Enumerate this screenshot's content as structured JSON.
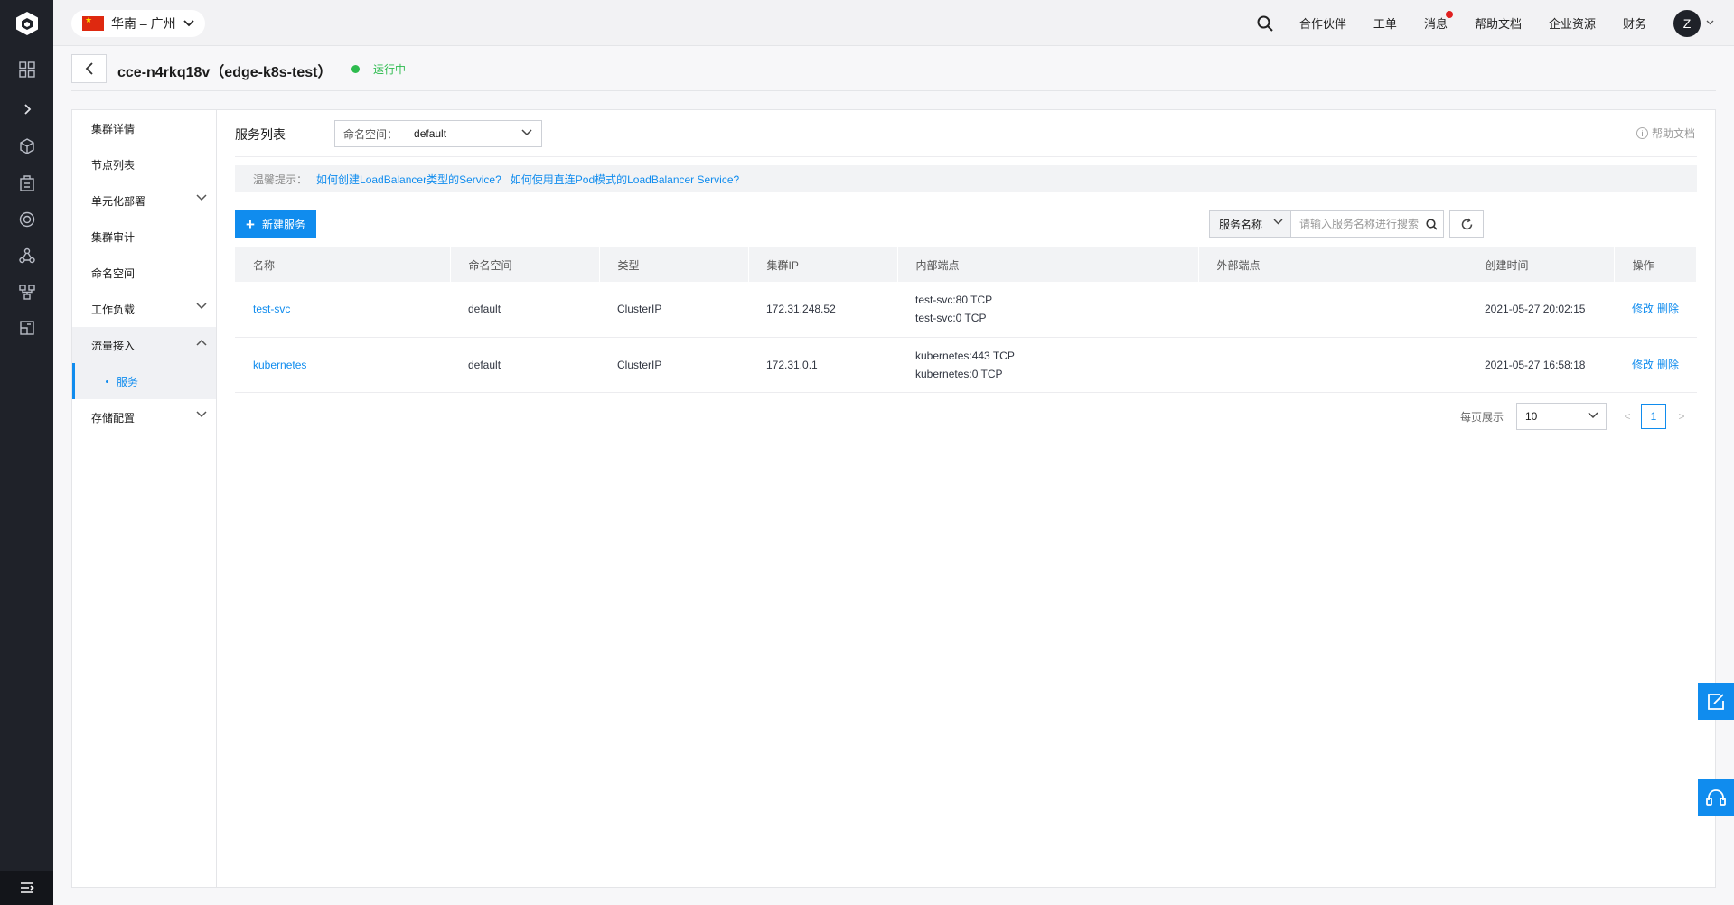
{
  "topbar": {
    "region": "华南 – 广州",
    "links": [
      "合作伙伴",
      "工单",
      "消息",
      "帮助文档",
      "企业资源",
      "财务"
    ],
    "avatar": "Z"
  },
  "header": {
    "cluster_title": "cce-n4rkq18v（edge-k8s-test）",
    "status": "运行中"
  },
  "subnav": {
    "items": [
      "集群详情",
      "节点列表",
      "单元化部署",
      "集群审计",
      "命名空间",
      "工作负载",
      "流量接入",
      "存储配置"
    ],
    "active_sub": "服务"
  },
  "content": {
    "title": "服务列表",
    "namespace_label": "命名空间：",
    "namespace_value": "default",
    "help_doc": "帮助文档",
    "tip_label": "温馨提示：",
    "tip_link1": "如何创建LoadBalancer类型的Service?",
    "tip_link2": "如何使用直连Pod模式的LoadBalancer Service?",
    "new_button": "新建服务",
    "filter_key": "服务名称",
    "search_placeholder": "请输入服务名称进行搜索"
  },
  "table": {
    "headers": [
      "名称",
      "命名空间",
      "类型",
      "集群IP",
      "内部端点",
      "外部端点",
      "创建时间",
      "操作"
    ],
    "rows": [
      {
        "name": "test-svc",
        "namespace": "default",
        "type": "ClusterIP",
        "cluster_ip": "172.31.248.52",
        "endpoint1": "test-svc:80 TCP",
        "endpoint2": "test-svc:0 TCP",
        "external": "",
        "created": "2021-05-27 20:02:15",
        "op_edit": "修改",
        "op_delete": "删除"
      },
      {
        "name": "kubernetes",
        "namespace": "default",
        "type": "ClusterIP",
        "cluster_ip": "172.31.0.1",
        "endpoint1": "kubernetes:443 TCP",
        "endpoint2": "kubernetes:0 TCP",
        "external": "",
        "created": "2021-05-27 16:58:18",
        "op_edit": "修改",
        "op_delete": "删除"
      }
    ]
  },
  "pager": {
    "page_size_label": "每页展示",
    "page_size": "10",
    "prev": "<",
    "current": "1",
    "next": ">"
  },
  "colors": {
    "accent": "#108cee",
    "running": "#2dbb4e",
    "rail": "#1f2229"
  }
}
